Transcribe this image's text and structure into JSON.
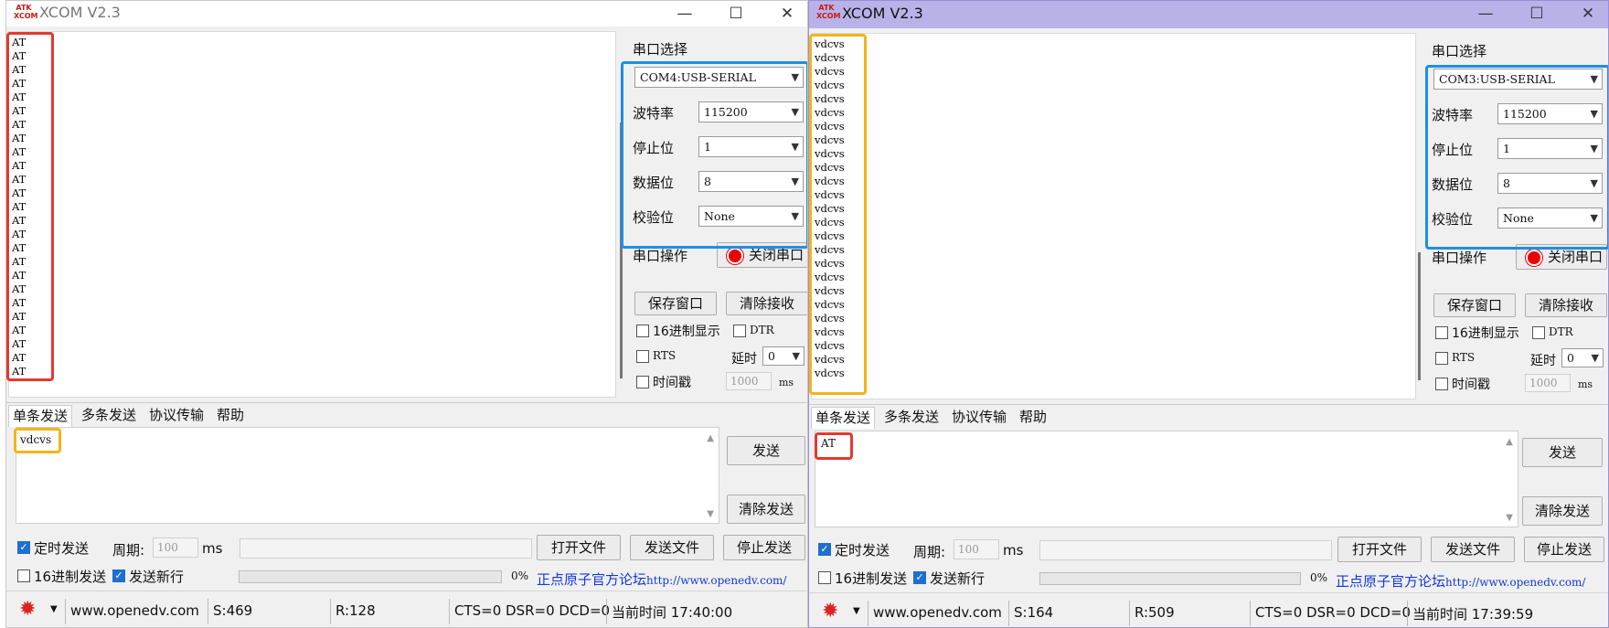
{
  "left": {
    "title": "XCOM V2.3",
    "logo_text": "ATK\nXCOM",
    "recv_lines": [
      "AT",
      "AT",
      "AT",
      "AT",
      "AT",
      "AT",
      "AT",
      "AT",
      "AT",
      "AT",
      "AT",
      "AT",
      "AT",
      "AT",
      "AT",
      "AT",
      "AT",
      "AT",
      "AT",
      "AT",
      "AT",
      "AT",
      "AT",
      "AT",
      "AT"
    ],
    "port_section": "串口选择",
    "port": "COM4:USB-SERIAL",
    "baud_label": "波特率",
    "baud": "115200",
    "stop_label": "停止位",
    "stop": "1",
    "data_label": "数据位",
    "data": "8",
    "parity_label": "校验位",
    "parity": "None",
    "op_label": "串口操作",
    "op_button": "关闭串口",
    "save_window": "保存窗口",
    "clear_recv": "清除接收",
    "hex_display": "16进制显示",
    "dtr": "DTR",
    "rts": "RTS",
    "delay_label": "延时",
    "delay": "0",
    "timestamp": "时间戳",
    "timestamp_value": "1000",
    "ms": "ms",
    "tabs": [
      "单条发送",
      "多条发送",
      "协议传输",
      "帮助"
    ],
    "send_text": "vdcvs",
    "send_button": "发送",
    "clear_send": "清除发送",
    "timed_send": "定时发送",
    "period_label": "周期:",
    "period": "100",
    "period_unit": "ms",
    "open_file": "打开文件",
    "send_file": "发送文件",
    "stop_send": "停止发送",
    "hex_send": "16进制发送",
    "newline": "发送新行",
    "percent": "0%",
    "forum": "正点原子官方论坛",
    "forum_url": "http://www.openedv.com/",
    "status_url": "www.openedv.com",
    "status_s": "S:469",
    "status_r": "R:128",
    "status_lines": "CTS=0 DSR=0 DCD=0",
    "status_time": "当前时间 17:40:00"
  },
  "right": {
    "title": "XCOM V2.3",
    "logo_text": "ATK\nXCOM",
    "recv_lines": [
      "vdcvs",
      "vdcvs",
      "vdcvs",
      "vdcvs",
      "vdcvs",
      "vdcvs",
      "vdcvs",
      "vdcvs",
      "vdcvs",
      "vdcvs",
      "vdcvs",
      "vdcvs",
      "vdcvs",
      "vdcvs",
      "vdcvs",
      "vdcvs",
      "vdcvs",
      "vdcvs",
      "vdcvs",
      "vdcvs",
      "vdcvs",
      "vdcvs",
      "vdcvs",
      "vdcvs",
      "vdcvs"
    ],
    "port_section": "串口选择",
    "port": "COM3:USB-SERIAL",
    "baud_label": "波特率",
    "baud": "115200",
    "stop_label": "停止位",
    "stop": "1",
    "data_label": "数据位",
    "data": "8",
    "parity_label": "校验位",
    "parity": "None",
    "op_label": "串口操作",
    "op_button": "关闭串口",
    "save_window": "保存窗口",
    "clear_recv": "清除接收",
    "hex_display": "16进制显示",
    "dtr": "DTR",
    "rts": "RTS",
    "delay_label": "延时",
    "delay": "0",
    "timestamp": "时间戳",
    "timestamp_value": "1000",
    "ms": "ms",
    "tabs": [
      "单条发送",
      "多条发送",
      "协议传输",
      "帮助"
    ],
    "send_text": "AT",
    "send_button": "发送",
    "clear_send": "清除发送",
    "timed_send": "定时发送",
    "period_label": "周期:",
    "period": "100",
    "period_unit": "ms",
    "open_file": "打开文件",
    "send_file": "发送文件",
    "stop_send": "停止发送",
    "hex_send": "16进制发送",
    "newline": "发送新行",
    "percent": "0%",
    "forum": "正点原子官方论坛",
    "forum_url": "http://www.openedv.com/",
    "status_url": "www.openedv.com",
    "status_s": "S:164",
    "status_r": "R:509",
    "status_lines": "CTS=0 DSR=0 DCD=0",
    "status_time": "当前时间 17:39:59"
  },
  "colors": {
    "highlight_red": "#e23a2e",
    "highlight_blue": "#1e8ee6",
    "highlight_orange": "#f3b41b",
    "link_blue": "#1338d8"
  }
}
